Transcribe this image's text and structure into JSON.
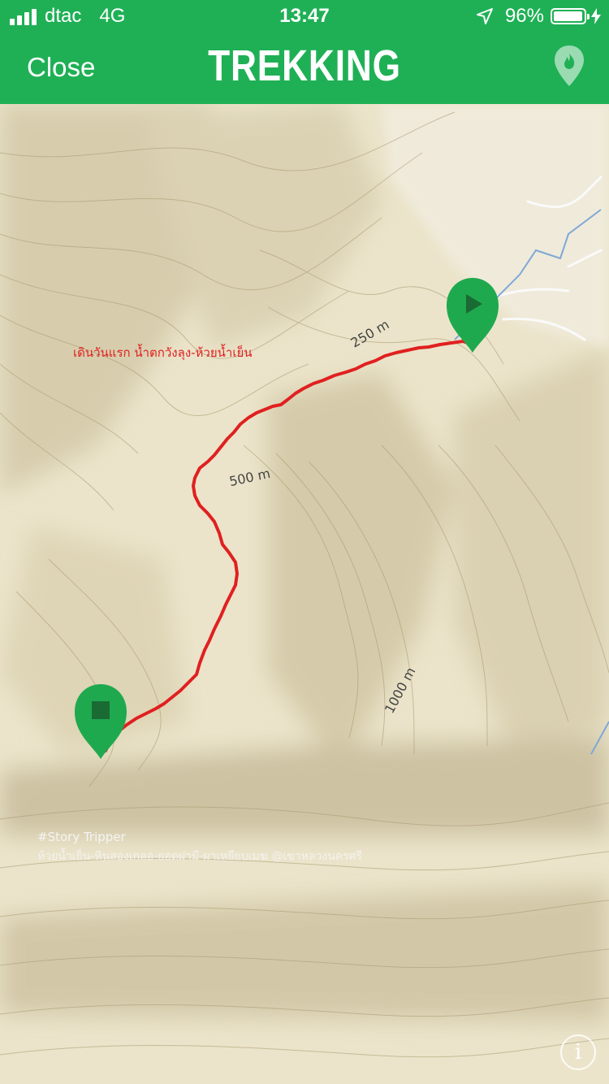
{
  "status_bar": {
    "carrier": "dtac",
    "network": "4G",
    "time": "13:47",
    "battery_text": "96%",
    "battery_level": 0.96
  },
  "header": {
    "close_label": "Close",
    "title": "TREKKING",
    "pin_icon": "location-pin-flame-icon"
  },
  "map": {
    "route_title": "เดินวันแรก น้ำตกวังลุง-ห้วยน้ำเย็น",
    "contour_labels": [
      "250 m",
      "500 m",
      "1000 m"
    ],
    "watermark_title": "#Story Tripper",
    "watermark_subtitle": "ห้วยน้ำเย็น-หินสองเกลอ-ยอดฝามี-ผาเหยียบเมฆ @เขาหลวงนครศรี",
    "start_marker_icon": "play-icon",
    "end_marker_icon": "stop-icon",
    "info_icon": "info-icon",
    "colors": {
      "route": "#e02020",
      "accent": "#1fb055",
      "terrain": "#e9e2c8"
    }
  }
}
